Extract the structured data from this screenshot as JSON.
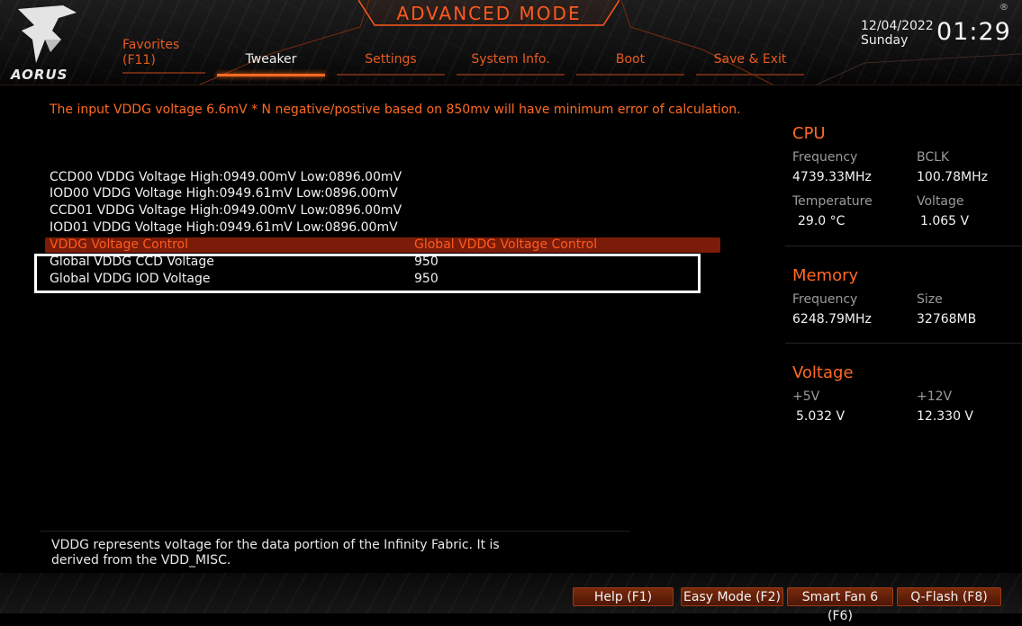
{
  "header": {
    "mode_title": "ADVANCED MODE",
    "logo_text": "AORUS",
    "favorites_label": "Favorites",
    "favorites_key": "(F11)",
    "tabs": [
      {
        "label": "Tweaker"
      },
      {
        "label": "Settings"
      },
      {
        "label": "System Info."
      },
      {
        "label": "Boot"
      },
      {
        "label": "Save & Exit"
      }
    ],
    "active_tab": "Tweaker",
    "date": "12/04/2022",
    "day": "Sunday",
    "time": "01:29",
    "reg_mark": "®"
  },
  "main": {
    "info_line": "The input VDDG voltage 6.6mV * N negative/postive based on 850mv will have minimum error of calculation.",
    "readings": [
      "CCD00 VDDG Voltage High:0949.00mV Low:0896.00mV",
      "IOD00 VDDG Voltage High:0949.61mV Low:0896.00mV",
      "CCD01 VDDG Voltage High:0949.00mV Low:0896.00mV",
      "IOD01 VDDG Voltage High:0949.61mV Low:0896.00mV"
    ],
    "settings": [
      {
        "label": "VDDG Voltage Control",
        "value": "Global VDDG Voltage Control"
      },
      {
        "label": "Global VDDG CCD Voltage",
        "value": "950"
      },
      {
        "label": "Global VDDG IOD Voltage",
        "value": "950"
      }
    ]
  },
  "side_panel": {
    "cpu": {
      "title": "CPU",
      "frequency_label": "Frequency",
      "frequency_value": "4739.33MHz",
      "bclk_label": "BCLK",
      "bclk_value": "100.78MHz",
      "temperature_label": "Temperature",
      "temperature_value": "29.0 °C",
      "voltage_label": "Voltage",
      "voltage_value": "1.065 V"
    },
    "memory": {
      "title": "Memory",
      "frequency_label": "Frequency",
      "frequency_value": "6248.79MHz",
      "size_label": "Size",
      "size_value": "32768MB"
    },
    "voltage": {
      "title": "Voltage",
      "v5_label": "+5V",
      "v5_value": "5.032 V",
      "v12_label": "+12V",
      "v12_value": "12.330 V"
    }
  },
  "help": {
    "text_line1": "VDDG represents voltage for the data portion of the Infinity Fabric. It is",
    "text_line2": "derived from the VDD_MISC."
  },
  "footer": {
    "buttons": [
      {
        "label": "Help (F1)"
      },
      {
        "label": "Easy Mode (F2)"
      },
      {
        "label": "Smart Fan 6 (F6)"
      },
      {
        "label": "Q-Flash (F8)"
      }
    ]
  },
  "colors": {
    "accent": "#ff6a22",
    "selected_row_bg": "#7a1c08",
    "button_bg": "#7a2a0c"
  }
}
